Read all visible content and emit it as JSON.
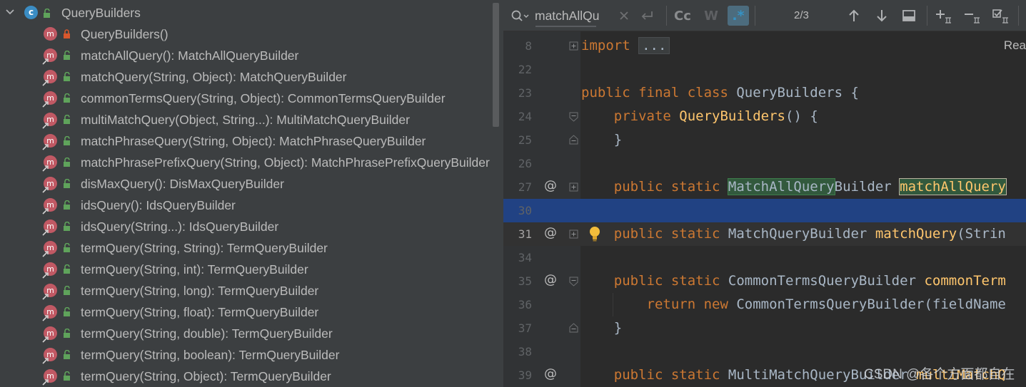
{
  "structure": {
    "class_name": "QueryBuilders",
    "class_badge": "c",
    "method_badge": "m",
    "methods": [
      {
        "label": "QueryBuilders()",
        "access": "private"
      },
      {
        "label": "matchAllQuery(): MatchAllQueryBuilder",
        "access": "public"
      },
      {
        "label": "matchQuery(String, Object): MatchQueryBuilder",
        "access": "public"
      },
      {
        "label": "commonTermsQuery(String, Object): CommonTermsQueryBuilder",
        "access": "public"
      },
      {
        "label": "multiMatchQuery(Object, String...): MultiMatchQueryBuilder",
        "access": "public"
      },
      {
        "label": "matchPhraseQuery(String, Object): MatchPhraseQueryBuilder",
        "access": "public"
      },
      {
        "label": "matchPhrasePrefixQuery(String, Object): MatchPhrasePrefixQueryBuilder",
        "access": "public"
      },
      {
        "label": "disMaxQuery(): DisMaxQueryBuilder",
        "access": "public"
      },
      {
        "label": "idsQuery(): IdsQueryBuilder",
        "access": "public"
      },
      {
        "label": "idsQuery(String...): IdsQueryBuilder",
        "access": "public"
      },
      {
        "label": "termQuery(String, String): TermQueryBuilder",
        "access": "public"
      },
      {
        "label": "termQuery(String, int): TermQueryBuilder",
        "access": "public"
      },
      {
        "label": "termQuery(String, long): TermQueryBuilder",
        "access": "public"
      },
      {
        "label": "termQuery(String, float): TermQueryBuilder",
        "access": "public"
      },
      {
        "label": "termQuery(String, double): TermQueryBuilder",
        "access": "public"
      },
      {
        "label": "termQuery(String, boolean): TermQueryBuilder",
        "access": "public"
      },
      {
        "label": "termQuery(String, Object): TermQueryBuilder",
        "access": "public"
      }
    ]
  },
  "find_bar": {
    "query": "matchAllQu",
    "match_case_label": "Cc",
    "words_label": "W",
    "regex_label": ".*",
    "match_count": "2/3"
  },
  "editor": {
    "reader_mode_label": "Rea",
    "lines": [
      {
        "num": "8",
        "tokens": [
          {
            "t": "import ",
            "c": "kw"
          },
          {
            "t": "...",
            "c": "fold-box"
          }
        ]
      },
      {
        "num": "22",
        "tokens": []
      },
      {
        "num": "23",
        "tokens": [
          {
            "t": "public final class ",
            "c": "kw"
          },
          {
            "t": "QueryBuilders {",
            "c": ""
          }
        ]
      },
      {
        "num": "24",
        "tokens": [
          {
            "t": "    private ",
            "c": "kw"
          },
          {
            "t": "QueryBuilders",
            "c": "fn"
          },
          {
            "t": "() {",
            "c": ""
          }
        ]
      },
      {
        "num": "25",
        "tokens": [
          {
            "t": "    }",
            "c": ""
          }
        ]
      },
      {
        "num": "26",
        "tokens": []
      },
      {
        "num": "27",
        "tokens": [
          {
            "t": "    public static ",
            "c": "kw"
          },
          {
            "t": "MatchAllQuery",
            "c": "hl"
          },
          {
            "t": "Builder ",
            "c": ""
          },
          {
            "t": "matchAllQuery",
            "c": "hl-cur"
          }
        ]
      },
      {
        "num": "30",
        "tokens": []
      },
      {
        "num": "31",
        "tokens": [
          {
            "t": "    public static ",
            "c": "kw"
          },
          {
            "t": "MatchQueryBuilder ",
            "c": ""
          },
          {
            "t": "matchQuery",
            "c": "fn"
          },
          {
            "t": "(Strin",
            "c": ""
          }
        ]
      },
      {
        "num": "34",
        "tokens": []
      },
      {
        "num": "35",
        "tokens": [
          {
            "t": "    public static ",
            "c": "kw"
          },
          {
            "t": "CommonTermsQueryBuilder ",
            "c": ""
          },
          {
            "t": "commonTerm",
            "c": "fn"
          }
        ]
      },
      {
        "num": "36",
        "tokens": [
          {
            "t": "        return new ",
            "c": "kw"
          },
          {
            "t": "CommonTermsQueryBuilder(fieldName",
            "c": ""
          }
        ]
      },
      {
        "num": "37",
        "tokens": [
          {
            "t": "    }",
            "c": ""
          }
        ]
      },
      {
        "num": "38",
        "tokens": []
      },
      {
        "num": "39",
        "tokens": [
          {
            "t": "    public static ",
            "c": "kw"
          },
          {
            "t": "MultiMatchQueryBuilder ",
            "c": ""
          },
          {
            "t": "multiMatchQ",
            "c": "fn"
          }
        ]
      }
    ],
    "implements_marker": "@",
    "watermark": "CSDN @各个方面都自在"
  },
  "colors": {
    "keyword": "#cc7832",
    "method": "#ffc66d",
    "selection": "#214283",
    "search_highlight": "#32593d",
    "method_badge": "#c15964",
    "class_badge": "#3b8dc4",
    "public_lock": "#5fa35b",
    "private_lock": "#d9572c"
  }
}
